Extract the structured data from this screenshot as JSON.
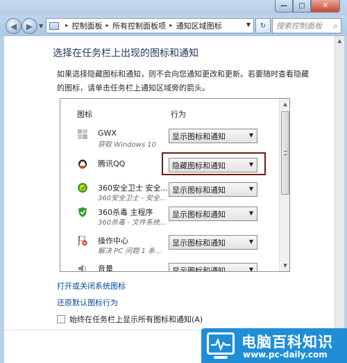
{
  "window": {
    "min_glyph": "—",
    "max_glyph": "□",
    "close_glyph": "✕"
  },
  "navbar": {
    "breadcrumbs": [
      "控制面板",
      "所有控制面板项",
      "通知区域图标"
    ],
    "search_placeholder": "搜索控制面板",
    "refresh_glyph": "↻"
  },
  "page": {
    "title": "选择在任务栏上出现的图标和通知",
    "description": "如果选择隐藏图标和通知，则不会向您通知更改和更新。若要随时查看隐藏的图标，请单击任务栏上通知区域旁的箭头。"
  },
  "list": {
    "col_icon": "图标",
    "col_behavior": "行为",
    "rows": [
      {
        "name": "GWX",
        "sub": "获取 Windows 10",
        "behavior": "显示图标和通知",
        "icon": "windows-logo-icon",
        "highlighted": false
      },
      {
        "name": "腾讯QQ",
        "sub": "",
        "behavior": "隐藏图标和通知",
        "icon": "qq-penguin-icon",
        "highlighted": true
      },
      {
        "name": "360安全卫士 安全...",
        "sub": "360安全卫士 - 安全...",
        "behavior": "显示图标和通知",
        "icon": "360-safeguard-icon",
        "highlighted": false
      },
      {
        "name": "360杀毒 主程序",
        "sub": "360杀毒 - 文件系统...",
        "behavior": "显示图标和通知",
        "icon": "360-antivirus-shield-icon",
        "highlighted": false
      },
      {
        "name": "操作中心",
        "sub": "解决 PC 问题 1 条...",
        "behavior": "显示图标和通知",
        "icon": "action-center-flag-icon",
        "highlighted": false
      },
      {
        "name": "音量",
        "sub": "",
        "behavior": "显示图标和通知",
        "icon": "speaker-icon",
        "highlighted": false
      }
    ]
  },
  "links": {
    "system_icons": "打开或关闭系统图标",
    "restore_defaults": "还原默认图标行为"
  },
  "checkbox": {
    "label": "始终在任务栏上显示所有图标和通知(A)",
    "checked": false
  },
  "watermark": {
    "title": "电脑百科知识",
    "url": "www.pc-daily.com"
  },
  "colors": {
    "highlight_border": "#6e1a14",
    "link": "#0b47a1",
    "watermark_bg": "#1f8ed7"
  }
}
